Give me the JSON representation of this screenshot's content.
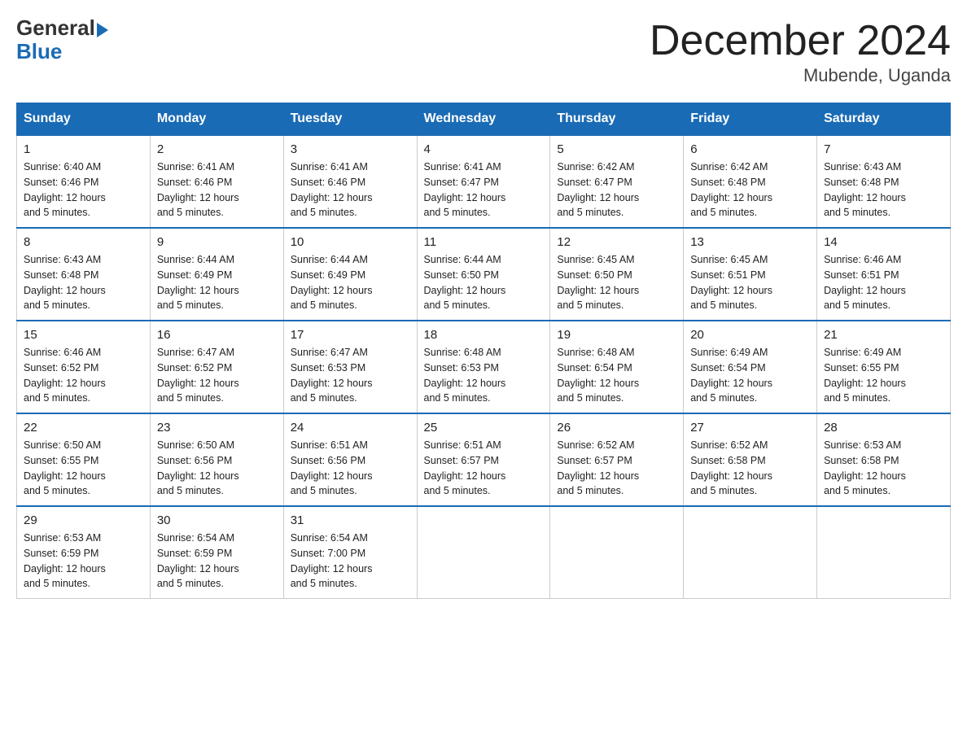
{
  "logo": {
    "general": "General",
    "blue": "Blue"
  },
  "title": {
    "month": "December 2024",
    "location": "Mubende, Uganda"
  },
  "headers": [
    "Sunday",
    "Monday",
    "Tuesday",
    "Wednesday",
    "Thursday",
    "Friday",
    "Saturday"
  ],
  "weeks": [
    [
      {
        "day": "1",
        "sunrise": "6:40 AM",
        "sunset": "6:46 PM",
        "daylight": "12 hours and 5 minutes."
      },
      {
        "day": "2",
        "sunrise": "6:41 AM",
        "sunset": "6:46 PM",
        "daylight": "12 hours and 5 minutes."
      },
      {
        "day": "3",
        "sunrise": "6:41 AM",
        "sunset": "6:46 PM",
        "daylight": "12 hours and 5 minutes."
      },
      {
        "day": "4",
        "sunrise": "6:41 AM",
        "sunset": "6:47 PM",
        "daylight": "12 hours and 5 minutes."
      },
      {
        "day": "5",
        "sunrise": "6:42 AM",
        "sunset": "6:47 PM",
        "daylight": "12 hours and 5 minutes."
      },
      {
        "day": "6",
        "sunrise": "6:42 AM",
        "sunset": "6:48 PM",
        "daylight": "12 hours and 5 minutes."
      },
      {
        "day": "7",
        "sunrise": "6:43 AM",
        "sunset": "6:48 PM",
        "daylight": "12 hours and 5 minutes."
      }
    ],
    [
      {
        "day": "8",
        "sunrise": "6:43 AM",
        "sunset": "6:48 PM",
        "daylight": "12 hours and 5 minutes."
      },
      {
        "day": "9",
        "sunrise": "6:44 AM",
        "sunset": "6:49 PM",
        "daylight": "12 hours and 5 minutes."
      },
      {
        "day": "10",
        "sunrise": "6:44 AM",
        "sunset": "6:49 PM",
        "daylight": "12 hours and 5 minutes."
      },
      {
        "day": "11",
        "sunrise": "6:44 AM",
        "sunset": "6:50 PM",
        "daylight": "12 hours and 5 minutes."
      },
      {
        "day": "12",
        "sunrise": "6:45 AM",
        "sunset": "6:50 PM",
        "daylight": "12 hours and 5 minutes."
      },
      {
        "day": "13",
        "sunrise": "6:45 AM",
        "sunset": "6:51 PM",
        "daylight": "12 hours and 5 minutes."
      },
      {
        "day": "14",
        "sunrise": "6:46 AM",
        "sunset": "6:51 PM",
        "daylight": "12 hours and 5 minutes."
      }
    ],
    [
      {
        "day": "15",
        "sunrise": "6:46 AM",
        "sunset": "6:52 PM",
        "daylight": "12 hours and 5 minutes."
      },
      {
        "day": "16",
        "sunrise": "6:47 AM",
        "sunset": "6:52 PM",
        "daylight": "12 hours and 5 minutes."
      },
      {
        "day": "17",
        "sunrise": "6:47 AM",
        "sunset": "6:53 PM",
        "daylight": "12 hours and 5 minutes."
      },
      {
        "day": "18",
        "sunrise": "6:48 AM",
        "sunset": "6:53 PM",
        "daylight": "12 hours and 5 minutes."
      },
      {
        "day": "19",
        "sunrise": "6:48 AM",
        "sunset": "6:54 PM",
        "daylight": "12 hours and 5 minutes."
      },
      {
        "day": "20",
        "sunrise": "6:49 AM",
        "sunset": "6:54 PM",
        "daylight": "12 hours and 5 minutes."
      },
      {
        "day": "21",
        "sunrise": "6:49 AM",
        "sunset": "6:55 PM",
        "daylight": "12 hours and 5 minutes."
      }
    ],
    [
      {
        "day": "22",
        "sunrise": "6:50 AM",
        "sunset": "6:55 PM",
        "daylight": "12 hours and 5 minutes."
      },
      {
        "day": "23",
        "sunrise": "6:50 AM",
        "sunset": "6:56 PM",
        "daylight": "12 hours and 5 minutes."
      },
      {
        "day": "24",
        "sunrise": "6:51 AM",
        "sunset": "6:56 PM",
        "daylight": "12 hours and 5 minutes."
      },
      {
        "day": "25",
        "sunrise": "6:51 AM",
        "sunset": "6:57 PM",
        "daylight": "12 hours and 5 minutes."
      },
      {
        "day": "26",
        "sunrise": "6:52 AM",
        "sunset": "6:57 PM",
        "daylight": "12 hours and 5 minutes."
      },
      {
        "day": "27",
        "sunrise": "6:52 AM",
        "sunset": "6:58 PM",
        "daylight": "12 hours and 5 minutes."
      },
      {
        "day": "28",
        "sunrise": "6:53 AM",
        "sunset": "6:58 PM",
        "daylight": "12 hours and 5 minutes."
      }
    ],
    [
      {
        "day": "29",
        "sunrise": "6:53 AM",
        "sunset": "6:59 PM",
        "daylight": "12 hours and 5 minutes."
      },
      {
        "day": "30",
        "sunrise": "6:54 AM",
        "sunset": "6:59 PM",
        "daylight": "12 hours and 5 minutes."
      },
      {
        "day": "31",
        "sunrise": "6:54 AM",
        "sunset": "7:00 PM",
        "daylight": "12 hours and 5 minutes."
      },
      null,
      null,
      null,
      null
    ]
  ],
  "labels": {
    "sunrise": "Sunrise:",
    "sunset": "Sunset:",
    "daylight": "Daylight:"
  }
}
